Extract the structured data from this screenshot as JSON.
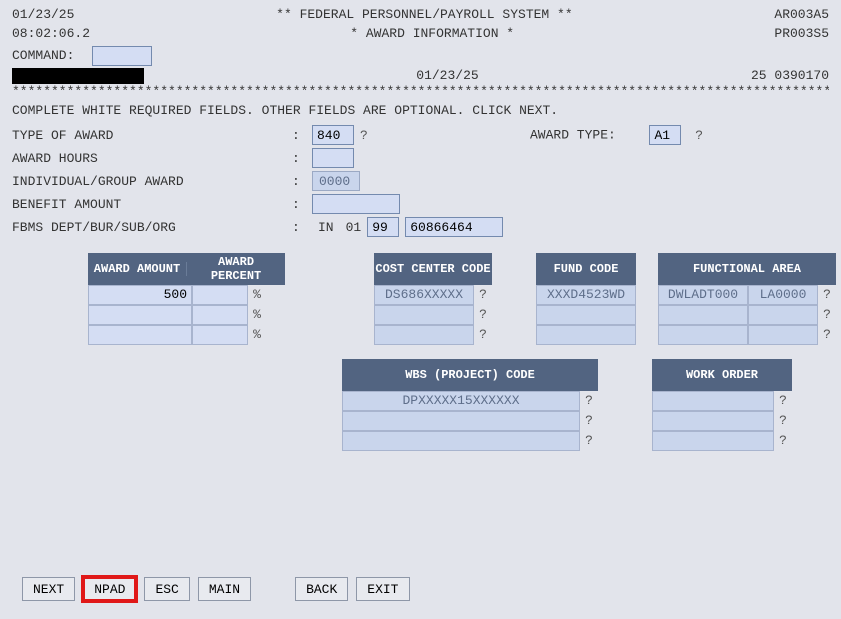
{
  "header": {
    "date": "01/23/25",
    "time": "08:02:06.2",
    "title1": "** FEDERAL PERSONNEL/PAYROLL SYSTEM **",
    "title2": "* AWARD INFORMATION *",
    "code_top": "AR003A5",
    "code_bottom": "PR003S5",
    "command_label": "COMMAND:",
    "line2_date": "01/23/25",
    "line2_id": "25 0390170"
  },
  "stars": "*********************************************************************************************************************************",
  "instruction": "COMPLETE WHITE REQUIRED FIELDS. OTHER FIELDS ARE OPTIONAL. CLICK NEXT.",
  "form": {
    "type_of_award_label": "TYPE OF AWARD",
    "type_of_award_value": "840",
    "award_type_label": "AWARD TYPE:",
    "award_type_value": "A1",
    "award_hours_label": "AWARD HOURS",
    "award_hours_value": "",
    "indiv_group_label": "INDIVIDUAL/GROUP AWARD",
    "indiv_group_value": "0000",
    "benefit_amount_label": "BENEFIT AMOUNT",
    "benefit_amount_value": "",
    "fbms_label": "FBMS DEPT/BUR/SUB/ORG",
    "fbms_in": "IN",
    "fbms_01": "01",
    "fbms_v1": "99",
    "fbms_v2": "60866464"
  },
  "tables": {
    "award_amount": {
      "hdr1": "AWARD AMOUNT",
      "hdr2": "AWARD PERCENT",
      "rows": [
        {
          "amount": "500",
          "percent": ""
        },
        {
          "amount": "",
          "percent": ""
        },
        {
          "amount": "",
          "percent": ""
        }
      ],
      "pct_sym": "%"
    },
    "cost_center": {
      "hdr": "COST CENTER CODE",
      "rows": [
        "DS686XXXXX",
        "",
        ""
      ]
    },
    "fund_code": {
      "hdr": "FUND CODE",
      "rows": [
        "XXXD4523WD",
        "",
        ""
      ]
    },
    "functional_area": {
      "hdr": "FUNCTIONAL AREA",
      "rows": [
        {
          "a": "DWLADT000",
          "b": "LA0000"
        },
        {
          "a": "",
          "b": ""
        },
        {
          "a": "",
          "b": ""
        }
      ]
    },
    "wbs": {
      "hdr": "WBS (PROJECT) CODE",
      "rows": [
        "DPXXXXX15XXXXXX",
        "",
        ""
      ]
    },
    "work_order": {
      "hdr": "WORK ORDER",
      "rows": [
        "",
        "",
        ""
      ]
    }
  },
  "buttons": {
    "next": "NEXT",
    "npad": "NPAD",
    "esc": "ESC",
    "main": "MAIN",
    "back": "BACK",
    "exit": "EXIT"
  },
  "q": "?"
}
